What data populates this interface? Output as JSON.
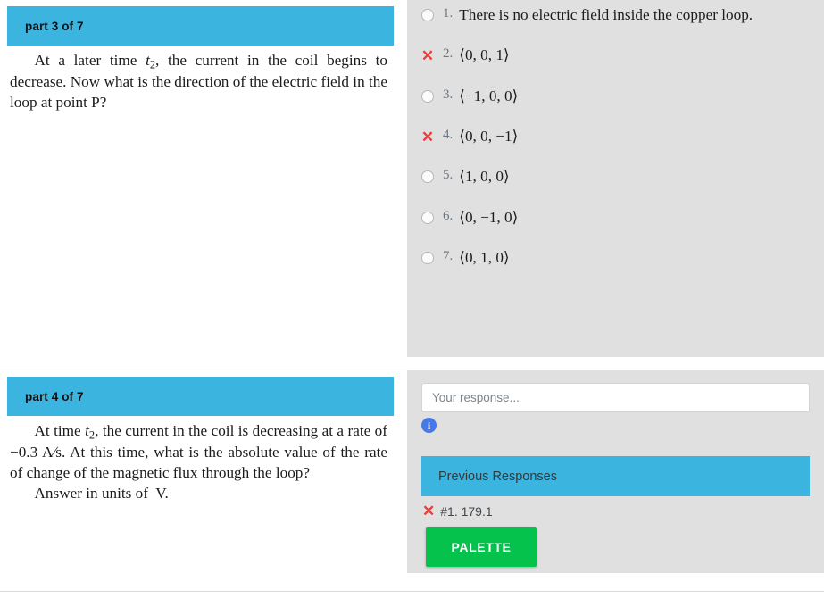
{
  "colors": {
    "header_blue": "#3bb4e0",
    "panel_gray": "#e0e0e0",
    "palette_green": "#04c24c",
    "x_red": "#ef3c36",
    "info_blue": "#4679e8"
  },
  "questions": [
    {
      "header_label": "part 3 of 7",
      "stem_paragraphs": [
        "At a later time t2, the current in the coil begins to decrease. Now what is the direction of the electric field in the loop at point P?"
      ],
      "choices": [
        {
          "number": "1.",
          "marker": "radio",
          "text": "There is no electric field inside the copper loop.",
          "multiline": true
        },
        {
          "number": "2.",
          "marker": "x",
          "text": "⟨0, 0, 1⟩",
          "multiline": false
        },
        {
          "number": "3.",
          "marker": "radio",
          "text": "⟨−1, 0, 0⟩",
          "multiline": false
        },
        {
          "number": "4.",
          "marker": "x",
          "text": "⟨0, 0, −1⟩",
          "multiline": false
        },
        {
          "number": "5.",
          "marker": "radio",
          "text": "⟨1, 0, 0⟩",
          "multiline": false
        },
        {
          "number": "6.",
          "marker": "radio",
          "text": "⟨0, −1, 0⟩",
          "multiline": false
        },
        {
          "number": "7.",
          "marker": "radio",
          "text": "⟨0, 1, 0⟩",
          "multiline": false
        }
      ]
    },
    {
      "header_label": "part 4 of 7",
      "stem_paragraphs": [
        "At time t2, the current in the coil is decreasing at a rate of −0.3 A/s. At this time, what is the absolute value of the rate of change of the magnetic flux through the loop?",
        "Answer in units of  V."
      ]
    }
  ],
  "answer_area": {
    "response_placeholder": "Your response...",
    "response_value": "",
    "info_icon_label": "i",
    "previous_responses_title": "Previous Responses",
    "previous_responses": [
      {
        "marker": "x",
        "text": "#1. 179.1"
      }
    ],
    "palette_button_label": "PALETTE"
  }
}
